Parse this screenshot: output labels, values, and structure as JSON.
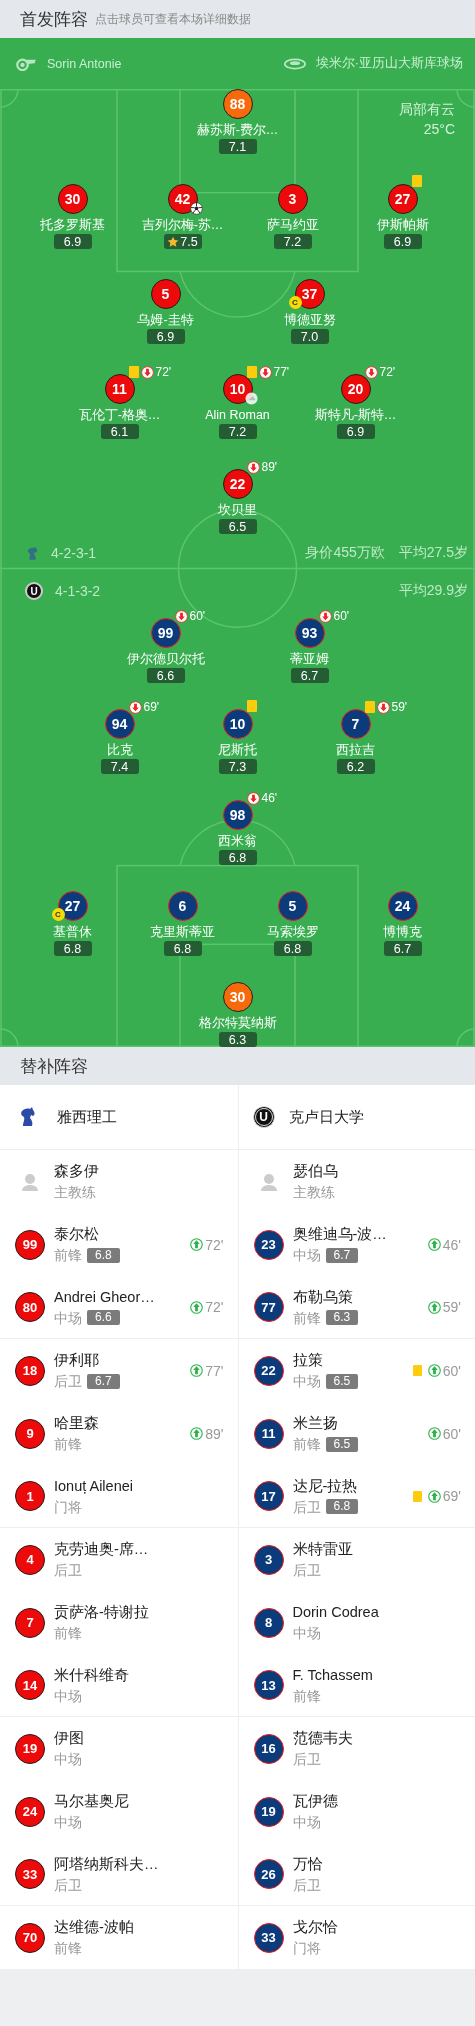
{
  "header": {
    "title": "首发阵容",
    "hint": "点击球员可查看本场详细数据"
  },
  "match_info": {
    "referee": "Sorin Antonie",
    "stadium": "埃米尔·亚历山大斯库球场",
    "weather": "局部有云",
    "temperature": "25°C"
  },
  "home": {
    "formation": "4-2-3-1",
    "market_value": "身价455万欧",
    "average_age": "平均27.5岁",
    "lines": [
      {
        "kind": "goalkeeper",
        "players": [
          {
            "number": "88",
            "name": "赫苏斯-费尔…",
            "rating": "7.1",
            "yellow_card": false,
            "goal": false,
            "assist": false,
            "best": false
          }
        ]
      },
      {
        "kind": "outfield",
        "players": [
          {
            "number": "30",
            "name": "托多罗斯基",
            "rating": "6.9",
            "yellow_card": false,
            "goal": false,
            "assist": false,
            "best": false
          },
          {
            "number": "42",
            "name": "吉列尔梅-苏…",
            "rating": "7.5",
            "yellow_card": false,
            "goal": true,
            "assist": false,
            "best": true
          },
          {
            "number": "3",
            "name": "萨马约亚",
            "rating": "7.2",
            "yellow_card": false,
            "goal": false,
            "assist": false,
            "best": false
          },
          {
            "number": "27",
            "name": "伊斯帕斯",
            "rating": "6.9",
            "yellow_card": true,
            "goal": false,
            "assist": false,
            "best": false
          }
        ]
      },
      {
        "kind": "outfield",
        "players": [
          {
            "number": "5",
            "name": "乌姆-圭特",
            "rating": "6.9",
            "yellow_card": false,
            "goal": false,
            "assist": false,
            "best": false
          },
          {
            "number": "37",
            "name": "博德亚努",
            "rating": "7.0",
            "captain_badge": "C",
            "yellow_card": false,
            "goal": false,
            "assist": false,
            "best": false
          }
        ]
      },
      {
        "kind": "outfield",
        "players": [
          {
            "number": "11",
            "name": "瓦伦丁-格奥…",
            "rating": "6.1",
            "yellow_card": true,
            "sub_off": "72'",
            "goal": false,
            "assist": false,
            "best": false
          },
          {
            "number": "10",
            "name": "Alin Roman",
            "rating": "7.2",
            "yellow_card": true,
            "sub_off": "77'",
            "goal": false,
            "assist": true,
            "best": false
          },
          {
            "number": "20",
            "name": "斯特凡-斯特…",
            "rating": "6.9",
            "yellow_card": false,
            "sub_off": "72'",
            "goal": false,
            "assist": false,
            "best": false
          }
        ]
      },
      {
        "kind": "outfield",
        "players": [
          {
            "number": "22",
            "name": "坎贝里",
            "rating": "6.5",
            "yellow_card": false,
            "sub_off": "89'",
            "goal": false,
            "assist": false,
            "best": false
          }
        ]
      }
    ]
  },
  "away": {
    "formation": "4-1-3-2",
    "logo_text": "U",
    "average_age": "平均29.9岁",
    "lines": [
      {
        "kind": "outfield",
        "players": [
          {
            "number": "99",
            "name": "伊尔德贝尔托",
            "rating": "6.6",
            "yellow_card": false,
            "sub_off": "60'",
            "goal": false,
            "assist": false,
            "best": false
          },
          {
            "number": "93",
            "name": "蒂亚姆",
            "rating": "6.7",
            "yellow_card": false,
            "sub_off": "60'",
            "goal": false,
            "assist": false,
            "best": false
          }
        ]
      },
      {
        "kind": "outfield",
        "players": [
          {
            "number": "94",
            "name": "比克",
            "rating": "7.4",
            "yellow_card": false,
            "sub_off": "69'",
            "goal": false,
            "assist": false,
            "best": false
          },
          {
            "number": "10",
            "name": "尼斯托",
            "rating": "7.3",
            "yellow_card": true,
            "goal": false,
            "assist": false,
            "best": false
          },
          {
            "number": "7",
            "name": "西拉吉",
            "rating": "6.2",
            "yellow_card": true,
            "sub_off": "59'",
            "goal": false,
            "assist": false,
            "best": false
          }
        ]
      },
      {
        "kind": "outfield",
        "players": [
          {
            "number": "98",
            "name": "西米翁",
            "rating": "6.8",
            "yellow_card": false,
            "sub_off": "46'",
            "goal": false,
            "assist": false,
            "best": false
          }
        ]
      },
      {
        "kind": "outfield",
        "players": [
          {
            "number": "27",
            "name": "基普休",
            "rating": "6.8",
            "captain_badge": "C",
            "yellow_card": false,
            "goal": false,
            "assist": false,
            "best": false
          },
          {
            "number": "6",
            "name": "克里斯蒂亚",
            "rating": "6.8",
            "yellow_card": false,
            "goal": false,
            "assist": false,
            "best": false
          },
          {
            "number": "5",
            "name": "马索埃罗",
            "rating": "6.8",
            "yellow_card": false,
            "goal": false,
            "assist": false,
            "best": false
          },
          {
            "number": "24",
            "name": "博博克",
            "rating": "6.7",
            "yellow_card": false,
            "goal": false,
            "assist": false,
            "best": false
          }
        ]
      },
      {
        "kind": "goalkeeper",
        "players": [
          {
            "number": "30",
            "name": "格尔特莫纳斯",
            "rating": "6.3",
            "yellow_card": false,
            "goal": false,
            "assist": false,
            "best": false
          }
        ]
      }
    ]
  },
  "substitutes": {
    "title": "替补阵容",
    "teams": [
      {
        "kind": "home",
        "name": "雅西理工",
        "coach": {
          "name": "森多伊",
          "role": "主教练"
        },
        "players": [
          {
            "number": "99",
            "name": "泰尔松",
            "position": "前锋",
            "rating": "6.8",
            "yellow_card": false,
            "sub_on": "72'"
          },
          {
            "number": "80",
            "name": "Andrei Gheor…",
            "position": "中场",
            "rating": "6.6",
            "yellow_card": false,
            "sub_on": "72'"
          },
          {
            "number": "18",
            "name": "伊利耶",
            "position": "后卫",
            "rating": "6.7",
            "yellow_card": false,
            "sub_on": "77'"
          },
          {
            "number": "9",
            "name": "哈里森",
            "position": "前锋",
            "yellow_card": false,
            "sub_on": "89'"
          },
          {
            "number": "1",
            "name": "Ionuț Ailenei",
            "position": "门将",
            "yellow_card": false
          },
          {
            "number": "4",
            "name": "克劳迪奥-席…",
            "position": "后卫",
            "yellow_card": false
          },
          {
            "number": "7",
            "name": "贡萨洛-特谢拉",
            "position": "前锋",
            "yellow_card": false
          },
          {
            "number": "14",
            "name": "米什科维奇",
            "position": "中场",
            "yellow_card": false
          },
          {
            "number": "19",
            "name": "伊图",
            "position": "中场",
            "yellow_card": false
          },
          {
            "number": "24",
            "name": "马尔基奥尼",
            "position": "中场",
            "yellow_card": false
          },
          {
            "number": "33",
            "name": "阿塔纳斯科夫…",
            "position": "后卫",
            "yellow_card": false
          },
          {
            "number": "70",
            "name": "达维德-波帕",
            "position": "前锋",
            "yellow_card": false
          }
        ]
      },
      {
        "kind": "away",
        "name": "克卢日大学",
        "logo_text": "U",
        "coach": {
          "name": "瑟伯乌",
          "role": "主教练"
        },
        "players": [
          {
            "number": "23",
            "name": "奥维迪乌-波…",
            "position": "中场",
            "rating": "6.7",
            "yellow_card": false,
            "sub_on": "46'"
          },
          {
            "number": "77",
            "name": "布勒乌策",
            "position": "前锋",
            "rating": "6.3",
            "yellow_card": false,
            "sub_on": "59'"
          },
          {
            "number": "22",
            "name": "拉策",
            "position": "中场",
            "rating": "6.5",
            "yellow_card": true,
            "sub_on": "60'"
          },
          {
            "number": "11",
            "name": "米兰扬",
            "position": "前锋",
            "rating": "6.5",
            "yellow_card": false,
            "sub_on": "60'"
          },
          {
            "number": "17",
            "name": "达尼-拉热",
            "position": "后卫",
            "rating": "6.8",
            "yellow_card": true,
            "sub_on": "69'"
          },
          {
            "number": "3",
            "name": "米特雷亚",
            "position": "后卫",
            "yellow_card": false
          },
          {
            "number": "8",
            "name": "Dorin Codrea",
            "position": "中场",
            "yellow_card": false
          },
          {
            "number": "13",
            "name": "F. Tchassem",
            "position": "前锋",
            "yellow_card": false
          },
          {
            "number": "16",
            "name": "范德韦夫",
            "position": "后卫",
            "yellow_card": false
          },
          {
            "number": "19",
            "name": "瓦伊德",
            "position": "中场",
            "yellow_card": false
          },
          {
            "number": "26",
            "name": "万恰",
            "position": "后卫",
            "yellow_card": false
          },
          {
            "number": "33",
            "name": "戈尔恰",
            "position": "门将",
            "yellow_card": false
          }
        ]
      }
    ]
  }
}
